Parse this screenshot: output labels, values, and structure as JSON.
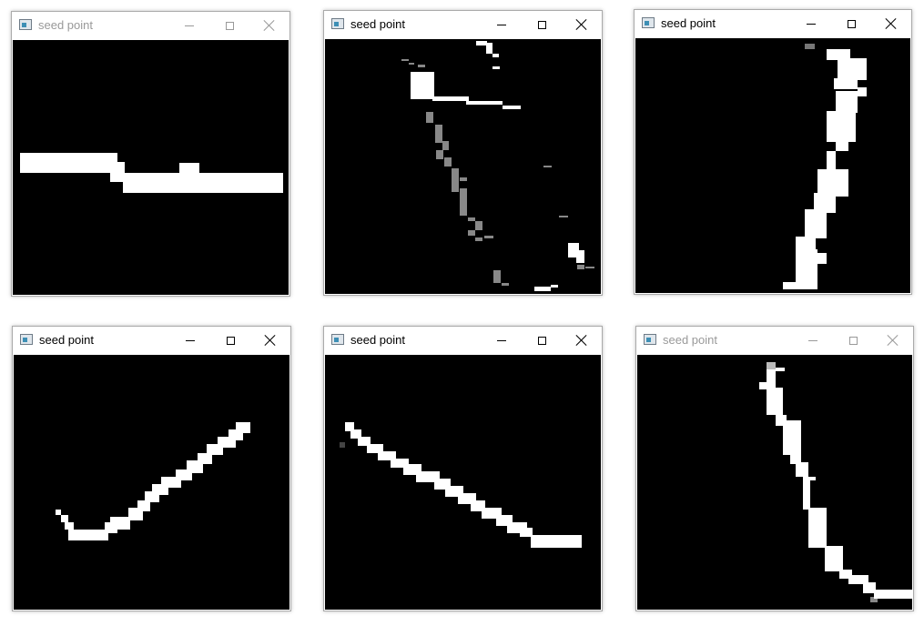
{
  "windows": [
    {
      "title": "seed point",
      "active": false
    },
    {
      "title": "seed point",
      "active": true
    },
    {
      "title": "seed point",
      "active": true
    },
    {
      "title": "seed point",
      "active": true
    },
    {
      "title": "seed point",
      "active": true
    },
    {
      "title": "seed point",
      "active": false
    }
  ],
  "colors": {
    "canvas": "#000000",
    "stroke": "#ffffff",
    "gray": "#888888",
    "dark_gray": "#444444"
  },
  "icons": {
    "app": "app-icon",
    "minimize": "minimize-icon",
    "maximize": "maximize-icon",
    "close": "close-icon"
  }
}
